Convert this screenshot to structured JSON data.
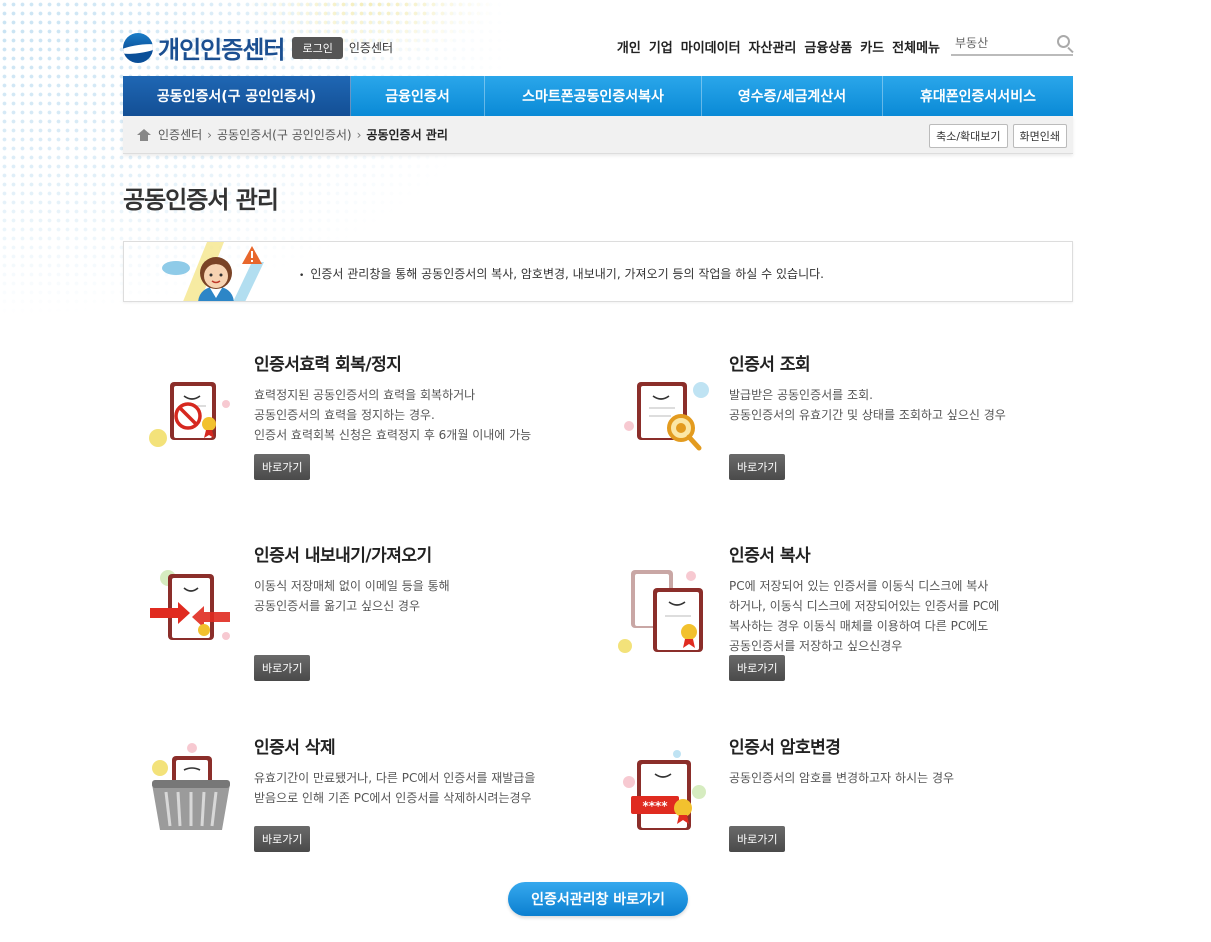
{
  "header": {
    "logo_text": "개인인증센터",
    "login_label": "로그인",
    "center_label": "인증센터",
    "top_menu": [
      "개인",
      "기업",
      "마이데이터",
      "자산관리",
      "금융상품",
      "카드",
      "전체메뉴"
    ],
    "search": {
      "value": "부동산"
    }
  },
  "nav": {
    "items": [
      {
        "label": "공동인증서(구 공인인증서)",
        "active": true
      },
      {
        "label": "금융인증서",
        "active": false
      },
      {
        "label": "스마트폰공동인증서복사",
        "active": false
      },
      {
        "label": "영수증/세금계산서",
        "active": false
      },
      {
        "label": "휴대폰인증서서비스",
        "active": false
      }
    ]
  },
  "breadcrumb": {
    "items": [
      "인증센터",
      "공동인증서(구 공인인증서)",
      "공동인증서 관리"
    ],
    "zoom_label": "축소/확대보기",
    "print_label": "화면인쇄"
  },
  "page_title": "공동인증서 관리",
  "info_text": "인증서 관리창을 통해 공동인증서의 복사, 암호변경, 내보내기, 가져오기 등의 작업을 하실 수 있습니다.",
  "cards": [
    {
      "title": "인증서효력 회복/정지",
      "desc": [
        "효력정지된 공동인증서의 효력을 회복하거나",
        "공동인증서의 효력을 정지하는 경우.",
        "인증서 효력회복 신청은 효력정지 후 6개월 이내에 가능"
      ],
      "button": "바로가기"
    },
    {
      "title": "인증서 조회",
      "desc": [
        "발급받은 공동인증서를 조회.",
        "공동인증서의 유효기간 및 상태를 조회하고 싶으신 경우"
      ],
      "button": "바로가기"
    },
    {
      "title": "인증서 내보내기/가져오기",
      "desc": [
        "이동식 저장매체 없이 이메일 등을 통해",
        "공동인증서를 옮기고 싶으신 경우"
      ],
      "button": "바로가기"
    },
    {
      "title": "인증서 복사",
      "desc": [
        "PC에 저장되어 있는 인증서를 이동식 디스크에 복사",
        "하거나, 이동식 디스크에 저장되어있는 인증서를 PC에",
        "복사하는 경우 이동식 매체를 이용하여 다른 PC에도",
        "공동인증서를 저장하고 싶으신경우"
      ],
      "button": "바로가기"
    },
    {
      "title": "인증서 삭제",
      "desc": [
        "유효기간이 만료됐거나, 다른 PC에서 인증서를 재발급을",
        "받음으로 인해 기존 PC에서 인증서를 삭제하시려는경우"
      ],
      "button": "바로가기"
    },
    {
      "title": "인증서 암호변경",
      "desc": [
        "공동인증서의 암호를 변경하고자 하시는 경우"
      ],
      "button": "바로가기"
    }
  ],
  "password_mask": "****",
  "main_button": "인증서관리창 바로가기",
  "colors": {
    "nav_blue": "#0a8ad6",
    "nav_active": "#134f95",
    "doc_red": "#b4302a",
    "cta_blue": "#0b7fd0"
  }
}
